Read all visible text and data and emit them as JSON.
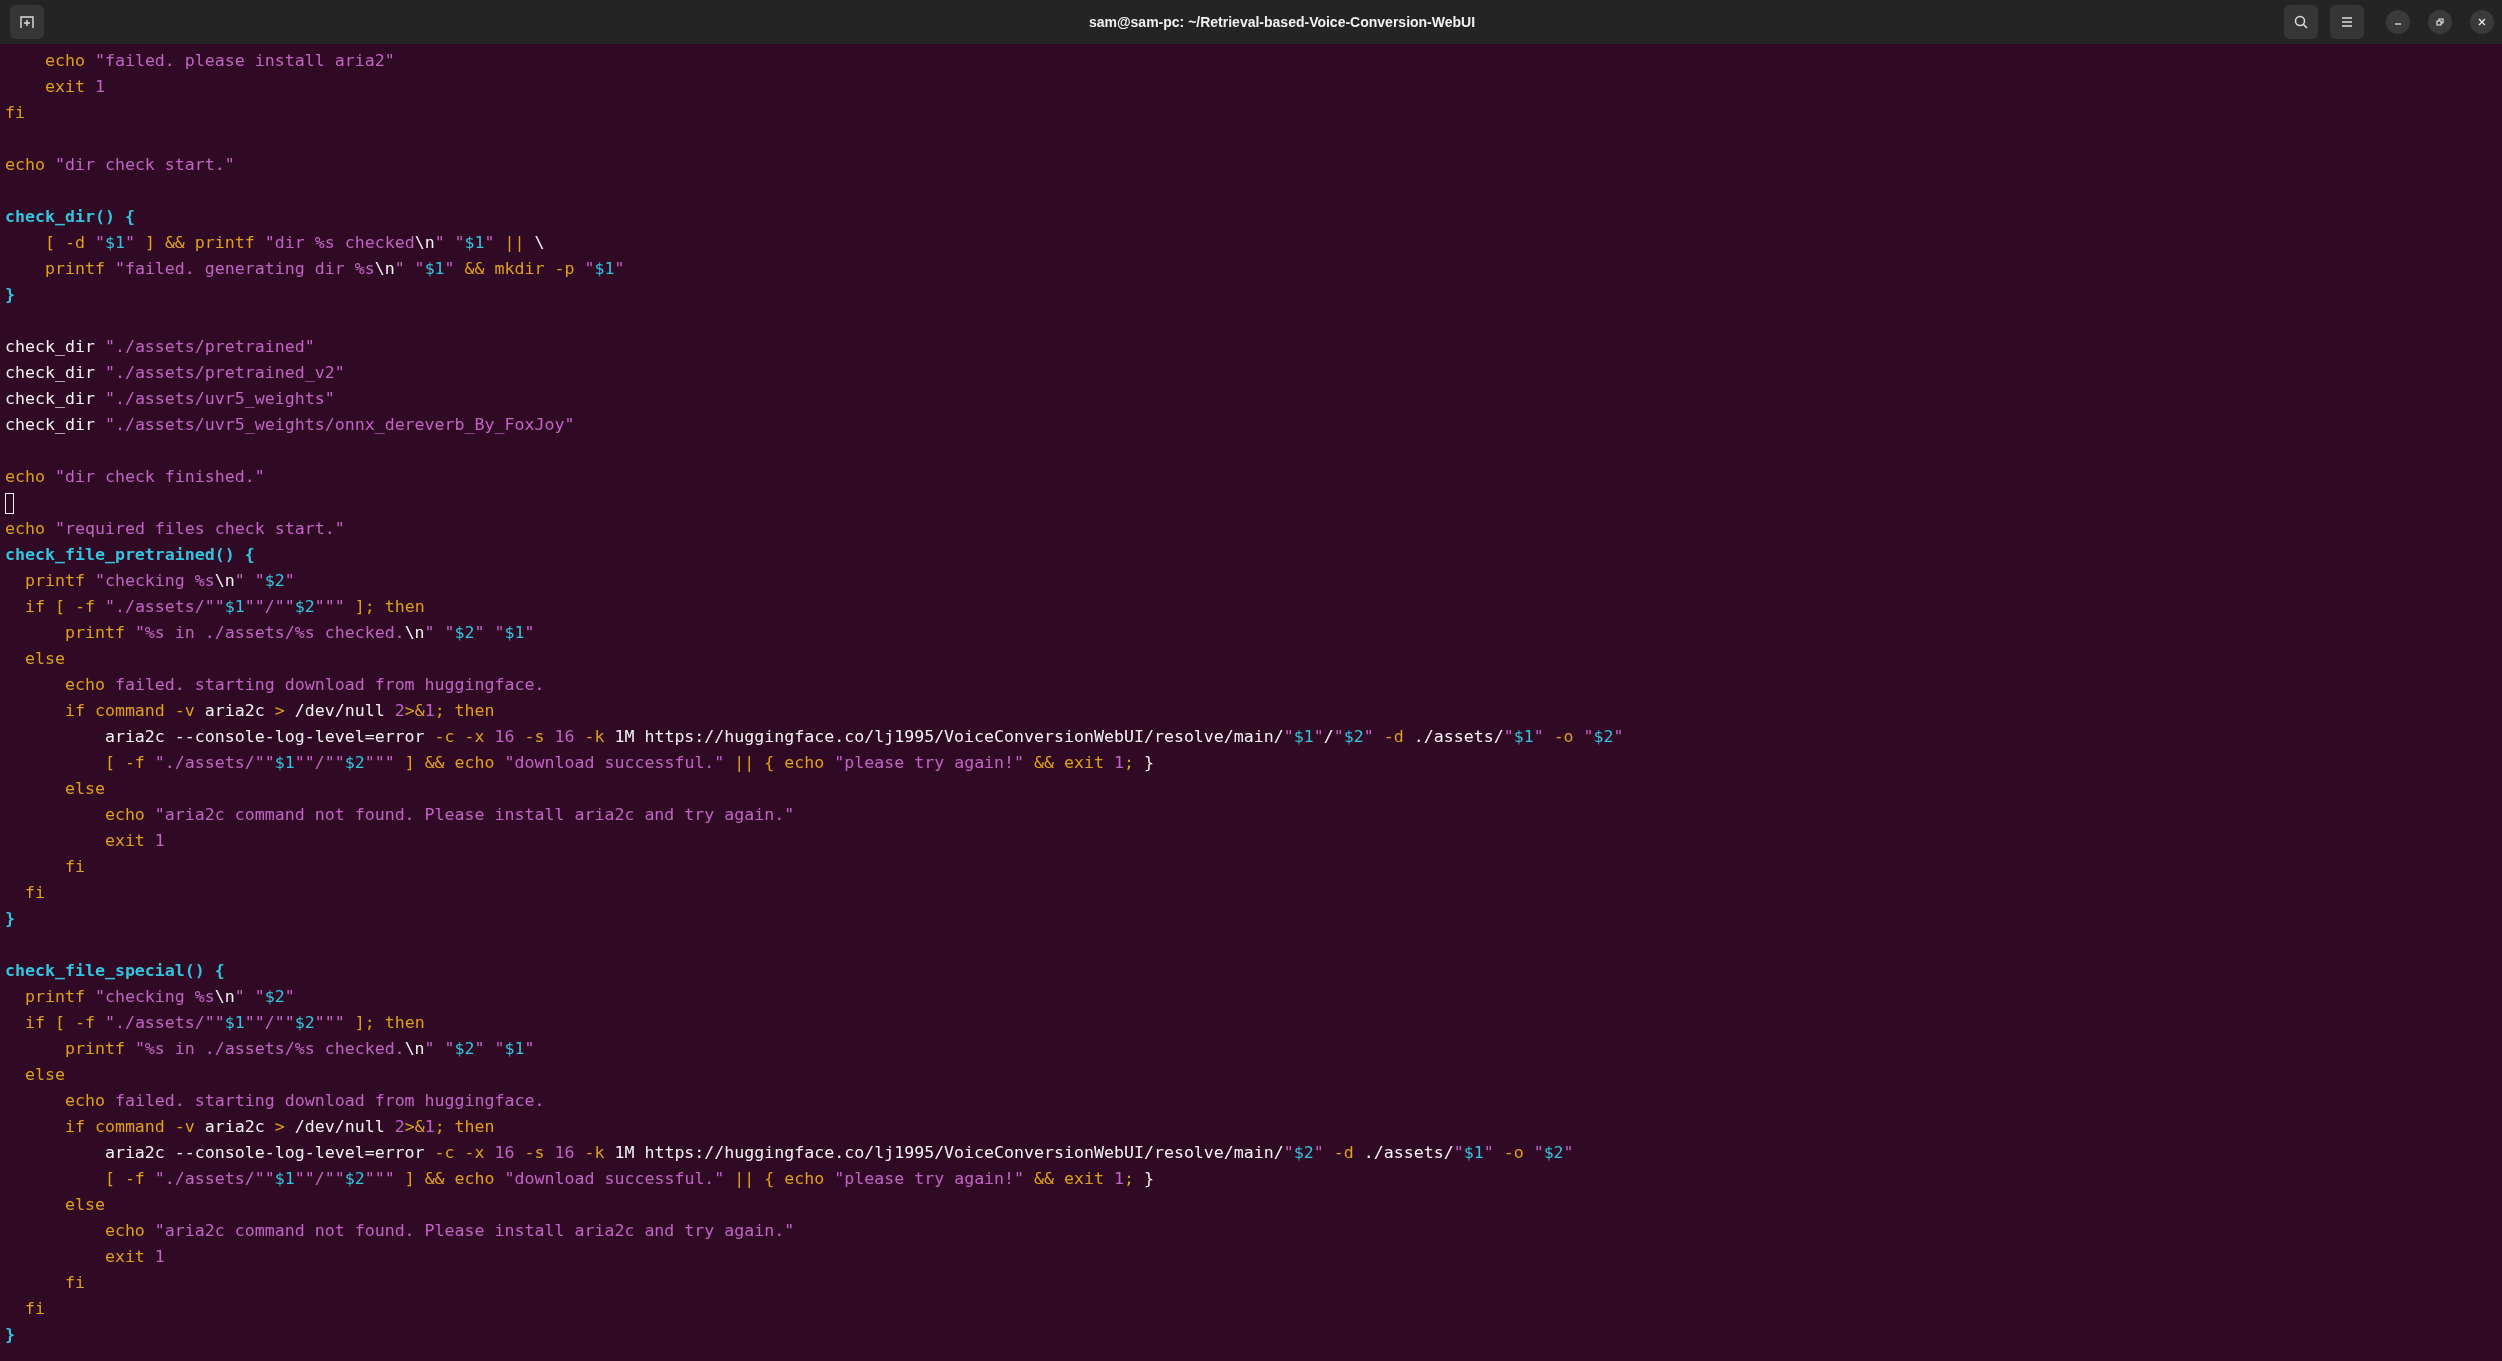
{
  "window": {
    "title": "sam@sam-pc: ~/Retrieval-based-Voice-Conversion-WebUI"
  },
  "terminal": {
    "lines": [
      {
        "cursor": false,
        "segments": [
          {
            "kind": "keyword",
            "text": "    echo"
          },
          {
            "kind": "string",
            "text": " \"failed. please install aria2\""
          }
        ]
      },
      {
        "cursor": false,
        "segments": [
          {
            "kind": "keyword",
            "text": "    exit "
          },
          {
            "kind": "number",
            "text": "1"
          }
        ]
      },
      {
        "cursor": false,
        "segments": [
          {
            "kind": "keyword",
            "text": "fi"
          }
        ]
      },
      {
        "kind": "blank"
      },
      {
        "cursor": false,
        "segments": [
          {
            "kind": "keyword",
            "text": "echo"
          },
          {
            "kind": "string",
            "text": " \"dir check start.\""
          }
        ]
      },
      {
        "kind": "blank"
      },
      {
        "cursor": false,
        "segments": [
          {
            "kind": "function",
            "text": "check_dir() {"
          }
        ]
      },
      {
        "cursor": false,
        "segments": [
          {
            "kind": "keyword",
            "text": "    [ -d "
          },
          {
            "kind": "string",
            "text": "\""
          },
          {
            "kind": "variable",
            "text": "$1"
          },
          {
            "kind": "string",
            "text": "\""
          },
          {
            "kind": "keyword",
            "text": " ] && printf "
          },
          {
            "kind": "string",
            "text": "\"dir %s checked"
          },
          {
            "kind": "plain",
            "text": "\\n"
          },
          {
            "kind": "string",
            "text": "\" \""
          },
          {
            "kind": "variable",
            "text": "$1"
          },
          {
            "kind": "string",
            "text": "\""
          },
          {
            "kind": "keyword",
            "text": " || "
          },
          {
            "kind": "plain",
            "text": "\\"
          }
        ]
      },
      {
        "cursor": false,
        "segments": [
          {
            "kind": "keyword",
            "text": "    printf "
          },
          {
            "kind": "string",
            "text": "\"failed. generating dir %s"
          },
          {
            "kind": "plain",
            "text": "\\n"
          },
          {
            "kind": "string",
            "text": "\" \""
          },
          {
            "kind": "variable",
            "text": "$1"
          },
          {
            "kind": "string",
            "text": "\""
          },
          {
            "kind": "keyword",
            "text": " && mkdir -p "
          },
          {
            "kind": "string",
            "text": "\""
          },
          {
            "kind": "variable",
            "text": "$1"
          },
          {
            "kind": "string",
            "text": "\""
          }
        ]
      },
      {
        "cursor": false,
        "segments": [
          {
            "kind": "function",
            "text": "}"
          }
        ]
      },
      {
        "kind": "blank"
      },
      {
        "cursor": false,
        "segments": [
          {
            "kind": "plain",
            "text": "check_dir"
          },
          {
            "kind": "string",
            "text": " \"./assets/pretrained\""
          }
        ]
      },
      {
        "cursor": false,
        "segments": [
          {
            "kind": "plain",
            "text": "check_dir"
          },
          {
            "kind": "string",
            "text": " \"./assets/pretrained_v2\""
          }
        ]
      },
      {
        "cursor": false,
        "segments": [
          {
            "kind": "plain",
            "text": "check_dir"
          },
          {
            "kind": "string",
            "text": " \"./assets/uvr5_weights\""
          }
        ]
      },
      {
        "cursor": false,
        "segments": [
          {
            "kind": "plain",
            "text": "check_dir"
          },
          {
            "kind": "string",
            "text": " \"./assets/uvr5_weights/onnx_dereverb_By_FoxJoy\""
          }
        ]
      },
      {
        "kind": "blank"
      },
      {
        "cursor": false,
        "segments": [
          {
            "kind": "keyword",
            "text": "echo"
          },
          {
            "kind": "string",
            "text": " \"dir check finished.\""
          }
        ]
      },
      {
        "kind": "cursor"
      },
      {
        "cursor": false,
        "segments": [
          {
            "kind": "keyword",
            "text": "echo"
          },
          {
            "kind": "string",
            "text": " \"required files check start.\""
          }
        ]
      },
      {
        "cursor": false,
        "segments": [
          {
            "kind": "function",
            "text": "check_file_pretrained() {"
          }
        ]
      },
      {
        "cursor": false,
        "segments": [
          {
            "kind": "keyword",
            "text": "  printf "
          },
          {
            "kind": "string",
            "text": "\"checking %s"
          },
          {
            "kind": "plain",
            "text": "\\n"
          },
          {
            "kind": "string",
            "text": "\" \""
          },
          {
            "kind": "variable",
            "text": "$2"
          },
          {
            "kind": "string",
            "text": "\""
          }
        ]
      },
      {
        "cursor": false,
        "segments": [
          {
            "kind": "keyword",
            "text": "  if [ -f "
          },
          {
            "kind": "string",
            "text": "\"./assets/\"\""
          },
          {
            "kind": "variable",
            "text": "$1"
          },
          {
            "kind": "string",
            "text": "\"\"/\"\""
          },
          {
            "kind": "variable",
            "text": "$2"
          },
          {
            "kind": "string",
            "text": "\"\"\""
          },
          {
            "kind": "keyword",
            "text": " ]; then"
          }
        ]
      },
      {
        "cursor": false,
        "segments": [
          {
            "kind": "keyword",
            "text": "      printf "
          },
          {
            "kind": "string",
            "text": "\"%s in ./assets/%s checked."
          },
          {
            "kind": "plain",
            "text": "\\n"
          },
          {
            "kind": "string",
            "text": "\" \""
          },
          {
            "kind": "variable",
            "text": "$2"
          },
          {
            "kind": "string",
            "text": "\" \""
          },
          {
            "kind": "variable",
            "text": "$1"
          },
          {
            "kind": "string",
            "text": "\""
          }
        ]
      },
      {
        "cursor": false,
        "segments": [
          {
            "kind": "keyword",
            "text": "  else"
          }
        ]
      },
      {
        "cursor": false,
        "segments": [
          {
            "kind": "keyword",
            "text": "      echo "
          },
          {
            "kind": "string",
            "text": "failed. starting download from huggingface."
          }
        ]
      },
      {
        "cursor": false,
        "segments": [
          {
            "kind": "keyword",
            "text": "      if command -v "
          },
          {
            "kind": "plain",
            "text": "aria2c"
          },
          {
            "kind": "keyword",
            "text": " > "
          },
          {
            "kind": "plain",
            "text": "/dev/null "
          },
          {
            "kind": "number",
            "text": "2"
          },
          {
            "kind": "keyword",
            "text": ">&"
          },
          {
            "kind": "number",
            "text": "1"
          },
          {
            "kind": "keyword",
            "text": "; then"
          }
        ]
      },
      {
        "cursor": false,
        "segments": [
          {
            "kind": "plain",
            "text": "          aria2c --console-log-level=error"
          },
          {
            "kind": "keyword",
            "text": " -c -x "
          },
          {
            "kind": "number",
            "text": "16"
          },
          {
            "kind": "keyword",
            "text": " -s "
          },
          {
            "kind": "number",
            "text": "16"
          },
          {
            "kind": "keyword",
            "text": " -k "
          },
          {
            "kind": "plain",
            "text": "1M https://huggingface.co/lj1995/VoiceConversionWebUI/resolve/main/"
          },
          {
            "kind": "string",
            "text": "\""
          },
          {
            "kind": "variable",
            "text": "$1"
          },
          {
            "kind": "string",
            "text": "\""
          },
          {
            "kind": "plain",
            "text": "/"
          },
          {
            "kind": "string",
            "text": "\""
          },
          {
            "kind": "variable",
            "text": "$2"
          },
          {
            "kind": "string",
            "text": "\""
          },
          {
            "kind": "keyword",
            "text": " -d "
          },
          {
            "kind": "plain",
            "text": "./assets/"
          },
          {
            "kind": "string",
            "text": "\""
          },
          {
            "kind": "variable",
            "text": "$1"
          },
          {
            "kind": "string",
            "text": "\""
          },
          {
            "kind": "keyword",
            "text": " -o "
          },
          {
            "kind": "string",
            "text": "\""
          },
          {
            "kind": "variable",
            "text": "$2"
          },
          {
            "kind": "string",
            "text": "\""
          }
        ]
      },
      {
        "cursor": false,
        "segments": [
          {
            "kind": "keyword",
            "text": "          [ -f "
          },
          {
            "kind": "string",
            "text": "\"./assets/\"\""
          },
          {
            "kind": "variable",
            "text": "$1"
          },
          {
            "kind": "string",
            "text": "\"\"/\"\""
          },
          {
            "kind": "variable",
            "text": "$2"
          },
          {
            "kind": "string",
            "text": "\"\"\""
          },
          {
            "kind": "keyword",
            "text": " ] && echo "
          },
          {
            "kind": "string",
            "text": "\"download successful.\""
          },
          {
            "kind": "keyword",
            "text": " || { echo "
          },
          {
            "kind": "string",
            "text": "\"please try again!\""
          },
          {
            "kind": "keyword",
            "text": " && exit "
          },
          {
            "kind": "number",
            "text": "1"
          },
          {
            "kind": "keyword",
            "text": ";"
          },
          {
            "kind": "plain",
            "text": " }"
          }
        ]
      },
      {
        "cursor": false,
        "segments": [
          {
            "kind": "keyword",
            "text": "      else"
          }
        ]
      },
      {
        "cursor": false,
        "segments": [
          {
            "kind": "keyword",
            "text": "          echo "
          },
          {
            "kind": "string",
            "text": "\"aria2c command not found. Please install aria2c and try again.\""
          }
        ]
      },
      {
        "cursor": false,
        "segments": [
          {
            "kind": "keyword",
            "text": "          exit "
          },
          {
            "kind": "number",
            "text": "1"
          }
        ]
      },
      {
        "cursor": false,
        "segments": [
          {
            "kind": "keyword",
            "text": "      fi"
          }
        ]
      },
      {
        "cursor": false,
        "segments": [
          {
            "kind": "keyword",
            "text": "  fi"
          }
        ]
      },
      {
        "cursor": false,
        "segments": [
          {
            "kind": "function",
            "text": "}"
          }
        ]
      },
      {
        "kind": "blank"
      },
      {
        "cursor": false,
        "segments": [
          {
            "kind": "function",
            "text": "check_file_special() {"
          }
        ]
      },
      {
        "cursor": false,
        "segments": [
          {
            "kind": "keyword",
            "text": "  printf "
          },
          {
            "kind": "string",
            "text": "\"checking %s"
          },
          {
            "kind": "plain",
            "text": "\\n"
          },
          {
            "kind": "string",
            "text": "\" \""
          },
          {
            "kind": "variable",
            "text": "$2"
          },
          {
            "kind": "string",
            "text": "\""
          }
        ]
      },
      {
        "cursor": false,
        "segments": [
          {
            "kind": "keyword",
            "text": "  if [ -f "
          },
          {
            "kind": "string",
            "text": "\"./assets/\"\""
          },
          {
            "kind": "variable",
            "text": "$1"
          },
          {
            "kind": "string",
            "text": "\"\"/\"\""
          },
          {
            "kind": "variable",
            "text": "$2"
          },
          {
            "kind": "string",
            "text": "\"\"\""
          },
          {
            "kind": "keyword",
            "text": " ]; then"
          }
        ]
      },
      {
        "cursor": false,
        "segments": [
          {
            "kind": "keyword",
            "text": "      printf "
          },
          {
            "kind": "string",
            "text": "\"%s in ./assets/%s checked."
          },
          {
            "kind": "plain",
            "text": "\\n"
          },
          {
            "kind": "string",
            "text": "\" \""
          },
          {
            "kind": "variable",
            "text": "$2"
          },
          {
            "kind": "string",
            "text": "\" \""
          },
          {
            "kind": "variable",
            "text": "$1"
          },
          {
            "kind": "string",
            "text": "\""
          }
        ]
      },
      {
        "cursor": false,
        "segments": [
          {
            "kind": "keyword",
            "text": "  else"
          }
        ]
      },
      {
        "cursor": false,
        "segments": [
          {
            "kind": "keyword",
            "text": "      echo "
          },
          {
            "kind": "string",
            "text": "failed. starting download from huggingface."
          }
        ]
      },
      {
        "cursor": false,
        "segments": [
          {
            "kind": "keyword",
            "text": "      if command -v "
          },
          {
            "kind": "plain",
            "text": "aria2c"
          },
          {
            "kind": "keyword",
            "text": " > "
          },
          {
            "kind": "plain",
            "text": "/dev/null "
          },
          {
            "kind": "number",
            "text": "2"
          },
          {
            "kind": "keyword",
            "text": ">&"
          },
          {
            "kind": "number",
            "text": "1"
          },
          {
            "kind": "keyword",
            "text": "; then"
          }
        ]
      },
      {
        "cursor": false,
        "segments": [
          {
            "kind": "plain",
            "text": "          aria2c --console-log-level=error"
          },
          {
            "kind": "keyword",
            "text": " -c -x "
          },
          {
            "kind": "number",
            "text": "16"
          },
          {
            "kind": "keyword",
            "text": " -s "
          },
          {
            "kind": "number",
            "text": "16"
          },
          {
            "kind": "keyword",
            "text": " -k "
          },
          {
            "kind": "plain",
            "text": "1M https://huggingface.co/lj1995/VoiceConversionWebUI/resolve/main/"
          },
          {
            "kind": "string",
            "text": "\""
          },
          {
            "kind": "variable",
            "text": "$2"
          },
          {
            "kind": "string",
            "text": "\""
          },
          {
            "kind": "keyword",
            "text": " -d "
          },
          {
            "kind": "plain",
            "text": "./assets/"
          },
          {
            "kind": "string",
            "text": "\""
          },
          {
            "kind": "variable",
            "text": "$1"
          },
          {
            "kind": "string",
            "text": "\""
          },
          {
            "kind": "keyword",
            "text": " -o "
          },
          {
            "kind": "string",
            "text": "\""
          },
          {
            "kind": "variable",
            "text": "$2"
          },
          {
            "kind": "string",
            "text": "\""
          }
        ]
      },
      {
        "cursor": false,
        "segments": [
          {
            "kind": "keyword",
            "text": "          [ -f "
          },
          {
            "kind": "string",
            "text": "\"./assets/\"\""
          },
          {
            "kind": "variable",
            "text": "$1"
          },
          {
            "kind": "string",
            "text": "\"\"/\"\""
          },
          {
            "kind": "variable",
            "text": "$2"
          },
          {
            "kind": "string",
            "text": "\"\"\""
          },
          {
            "kind": "keyword",
            "text": " ] && echo "
          },
          {
            "kind": "string",
            "text": "\"download successful.\""
          },
          {
            "kind": "keyword",
            "text": " || { echo "
          },
          {
            "kind": "string",
            "text": "\"please try again!\""
          },
          {
            "kind": "keyword",
            "text": " && exit "
          },
          {
            "kind": "number",
            "text": "1"
          },
          {
            "kind": "keyword",
            "text": ";"
          },
          {
            "kind": "plain",
            "text": " }"
          }
        ]
      },
      {
        "cursor": false,
        "segments": [
          {
            "kind": "keyword",
            "text": "      else"
          }
        ]
      },
      {
        "cursor": false,
        "segments": [
          {
            "kind": "keyword",
            "text": "          echo "
          },
          {
            "kind": "string",
            "text": "\"aria2c command not found. Please install aria2c and try again.\""
          }
        ]
      },
      {
        "cursor": false,
        "segments": [
          {
            "kind": "keyword",
            "text": "          exit "
          },
          {
            "kind": "number",
            "text": "1"
          }
        ]
      },
      {
        "cursor": false,
        "segments": [
          {
            "kind": "keyword",
            "text": "      fi"
          }
        ]
      },
      {
        "cursor": false,
        "segments": [
          {
            "kind": "keyword",
            "text": "  fi"
          }
        ]
      },
      {
        "cursor": false,
        "segments": [
          {
            "kind": "function",
            "text": "}"
          }
        ]
      }
    ]
  }
}
